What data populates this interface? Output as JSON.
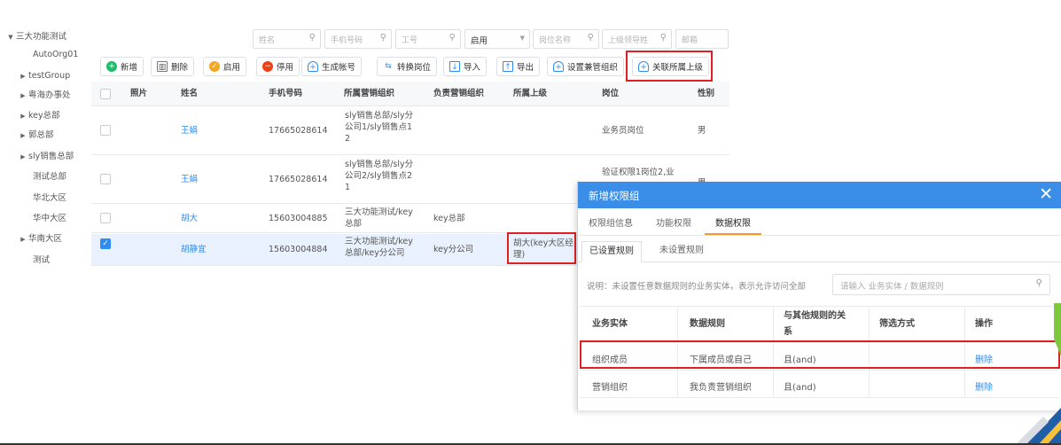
{
  "tree": {
    "items": [
      {
        "label": "三大功能测试",
        "arrow": "▼",
        "level": 0
      },
      {
        "label": "AutoOrg01",
        "arrow": "",
        "level": 1
      },
      {
        "label": "testGroup",
        "arrow": "▶",
        "level": 1
      },
      {
        "label": "粤海办事处",
        "arrow": "▶",
        "level": 1
      },
      {
        "label": "key总部",
        "arrow": "▶",
        "level": 1
      },
      {
        "label": "郭总部",
        "arrow": "▶",
        "level": 1
      },
      {
        "label": "sly销售总部",
        "arrow": "▶",
        "level": 1
      },
      {
        "label": "测试总部",
        "arrow": "",
        "level": 1
      },
      {
        "label": "华北大区",
        "arrow": "",
        "level": 1
      },
      {
        "label": "华中大区",
        "arrow": "",
        "level": 1
      },
      {
        "label": "华南大区",
        "arrow": "▶",
        "level": 1
      },
      {
        "label": "测试",
        "arrow": "",
        "level": 1
      }
    ]
  },
  "filters": {
    "name_placeholder": "姓名",
    "phone_placeholder": "手机号码",
    "jobno_placeholder": "工号",
    "status_value": "启用",
    "position_placeholder": "岗位名称",
    "leader_placeholder": "上级领导姓",
    "email_placeholder": "邮箱"
  },
  "toolbar": {
    "add": "新增",
    "delete": "删除",
    "enable": "启用",
    "disable": "停用",
    "gen_account": "生成帐号",
    "switch_position": "转换岗位",
    "import": "导入",
    "export": "导出",
    "set_part_org": "设置兼管组织",
    "link_superior": "关联所属上级"
  },
  "table": {
    "headers": [
      "照片",
      "姓名",
      "手机号码",
      "所属营销组织",
      "负责营销组织",
      "所属上级",
      "岗位",
      "性别"
    ],
    "rows": [
      {
        "name": "王娟",
        "phone": "17665028614",
        "org": [
          "sly销售总部/sly分",
          "公司1/sly销售点1",
          "2"
        ],
        "resp": "",
        "superior": [],
        "position": "业务员岗位",
        "gender": "男",
        "checked": false
      },
      {
        "name": "王娟",
        "phone": "17665028614",
        "org": [
          "sly销售总部/sly分",
          "公司2/sly销售点2",
          "1"
        ],
        "resp": "",
        "superior": [],
        "position": "验证权限1岗位2,业",
        "gender": "男",
        "checked": false
      },
      {
        "name": "胡大",
        "phone": "15603004885",
        "org": [
          "三大功能测试/key",
          "总部"
        ],
        "resp": "key总部",
        "superior": [],
        "position": "",
        "gender": "",
        "checked": false
      },
      {
        "name": "胡静宜",
        "phone": "15603004884",
        "org": [
          "三大功能测试/key",
          "总部/key分公司"
        ],
        "resp": "key分公司",
        "superior": [
          "胡大(key大区经",
          "理)"
        ],
        "position": "",
        "gender": "",
        "checked": true
      }
    ]
  },
  "dialog": {
    "title": "新增权限组",
    "close": "✕",
    "tabs": [
      "权限组信息",
      "功能权限",
      "数据权限"
    ],
    "subtabs": [
      "已设置规则",
      "未设置规则"
    ],
    "note": "说明：未设置任意数据规则的业务实体，表示允许访问全部",
    "search_placeholder": "请输入 业务实体 / 数据规则",
    "headers": [
      "业务实体",
      "数据规则",
      "与其他规则的关",
      "系",
      "筛选方式",
      "操作"
    ],
    "rows": [
      {
        "entity": "组织成员",
        "rule": "下属成员或自己",
        "relation": "且(and)",
        "filter": "",
        "action": "删除"
      },
      {
        "entity": "营销组织",
        "rule": "我负责营销组织",
        "relation": "且(and)",
        "filter": "",
        "action": "删除"
      }
    ]
  },
  "colors": {
    "accent": "#2d8cf0",
    "dialog_header": "#3b8ee8",
    "highlight": "#e02020",
    "tab_underline": "#f39a2b"
  }
}
